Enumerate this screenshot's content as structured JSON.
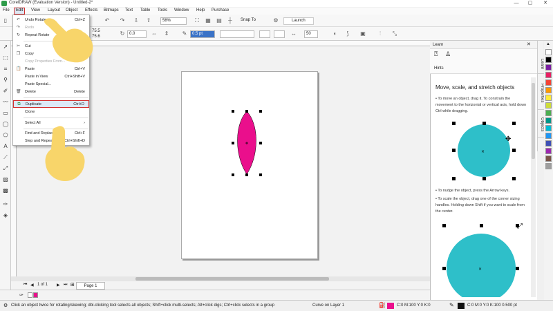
{
  "window": {
    "title": "CorelDRAW (Evaluation Version) - Untitled-2*",
    "minimize": "—",
    "maximize": "▢",
    "close": "✕"
  },
  "menus": [
    "File",
    "Edit",
    "View",
    "Layout",
    "Object",
    "Effects",
    "Bitmaps",
    "Text",
    "Table",
    "Tools",
    "Window",
    "Help",
    "Purchase"
  ],
  "toolbar1": {
    "zoom": "58%",
    "snap_to": "Snap To",
    "launch": "Launch"
  },
  "toolbar2": {
    "size_w": "75.5",
    "size_h": "75.6",
    "rotation": "0.0",
    "outline_width": "0.5 pt",
    "value_50": "50"
  },
  "edit_menu": {
    "items": [
      {
        "label": "Undo Rotate",
        "shortcut": "Ctrl+Z",
        "disabled": false,
        "icon": "↶"
      },
      {
        "label": "Redo",
        "shortcut": "",
        "disabled": true,
        "icon": "↷"
      },
      {
        "label": "Repeat Rotate",
        "shortcut": "",
        "disabled": false,
        "icon": "↻"
      },
      {
        "label": "Cut",
        "shortcut": "",
        "disabled": false,
        "icon": "✂"
      },
      {
        "label": "Copy",
        "shortcut": "",
        "disabled": false,
        "icon": "❐"
      },
      {
        "label": "Copy Properties From...",
        "shortcut": "",
        "disabled": true,
        "icon": ""
      },
      {
        "label": "Paste",
        "shortcut": "Ctrl+V",
        "disabled": false,
        "icon": "📋"
      },
      {
        "label": "Paste in View",
        "shortcut": "Ctrl+Shift+V",
        "disabled": false,
        "icon": ""
      },
      {
        "label": "Paste Special...",
        "shortcut": "",
        "disabled": false,
        "icon": ""
      },
      {
        "label": "Delete",
        "shortcut": "Delete",
        "disabled": false,
        "icon": "🗑"
      },
      {
        "label": "Duplicate",
        "shortcut": "Ctrl+D",
        "disabled": false,
        "icon": "⧉"
      },
      {
        "label": "Clone",
        "shortcut": "",
        "disabled": false,
        "icon": ""
      },
      {
        "label": "Select All",
        "shortcut": "",
        "disabled": false,
        "icon": ""
      },
      {
        "label": "Find and Replace",
        "shortcut": "Ctrl+F",
        "disabled": false,
        "icon": ""
      },
      {
        "label": "Step and Repeat...",
        "shortcut": "Ctrl+Shift+D",
        "disabled": false,
        "icon": ""
      }
    ]
  },
  "page_nav": {
    "page_count": "1 of 1",
    "page_tab": "Page 1"
  },
  "docker": {
    "title": "Learn",
    "hints_label": "Hints",
    "heading": "Move, scale, and stretch objects",
    "bullet1": "To move an object, drag it. To constrain the movement to the horizontal or vertical axis, hold down Ctrl while dragging.",
    "bullet2": "To nudge the object, press the Arrow keys.",
    "bullet3": "To scale the object, drag one of the corner sizing handles. Holding down Shift if you want to scale from the center."
  },
  "side_tabs": [
    "Learn",
    "Properties",
    "Objects"
  ],
  "status": {
    "hint": "Click an object twice for rotating/skewing; dbl-clicking tool selects all objects; Shift+click multi-selects; Alt+click digs; Ctrl+click selects in a group",
    "layer": "Curve on Layer 1",
    "fill": "C:0 M:100 Y:0 K:0",
    "outline": "C:0 M:0 Y:0 K:100  0.500 pt"
  },
  "colors": {
    "petal": "#ea0f8c",
    "accent_red": "#d32f2f",
    "teal": "#2ebfc9",
    "hand": "#f8d56a"
  },
  "palette_colors": [
    "#ffffff",
    "#000000",
    "#7b1fa2",
    "#e91e63",
    "#f44336",
    "#ff9800",
    "#ffeb3b",
    "#cddc39",
    "#4caf50",
    "#009688",
    "#00bcd4",
    "#2196f3",
    "#3f51b5",
    "#9c27b0",
    "#795548",
    "#9e9e9e"
  ]
}
